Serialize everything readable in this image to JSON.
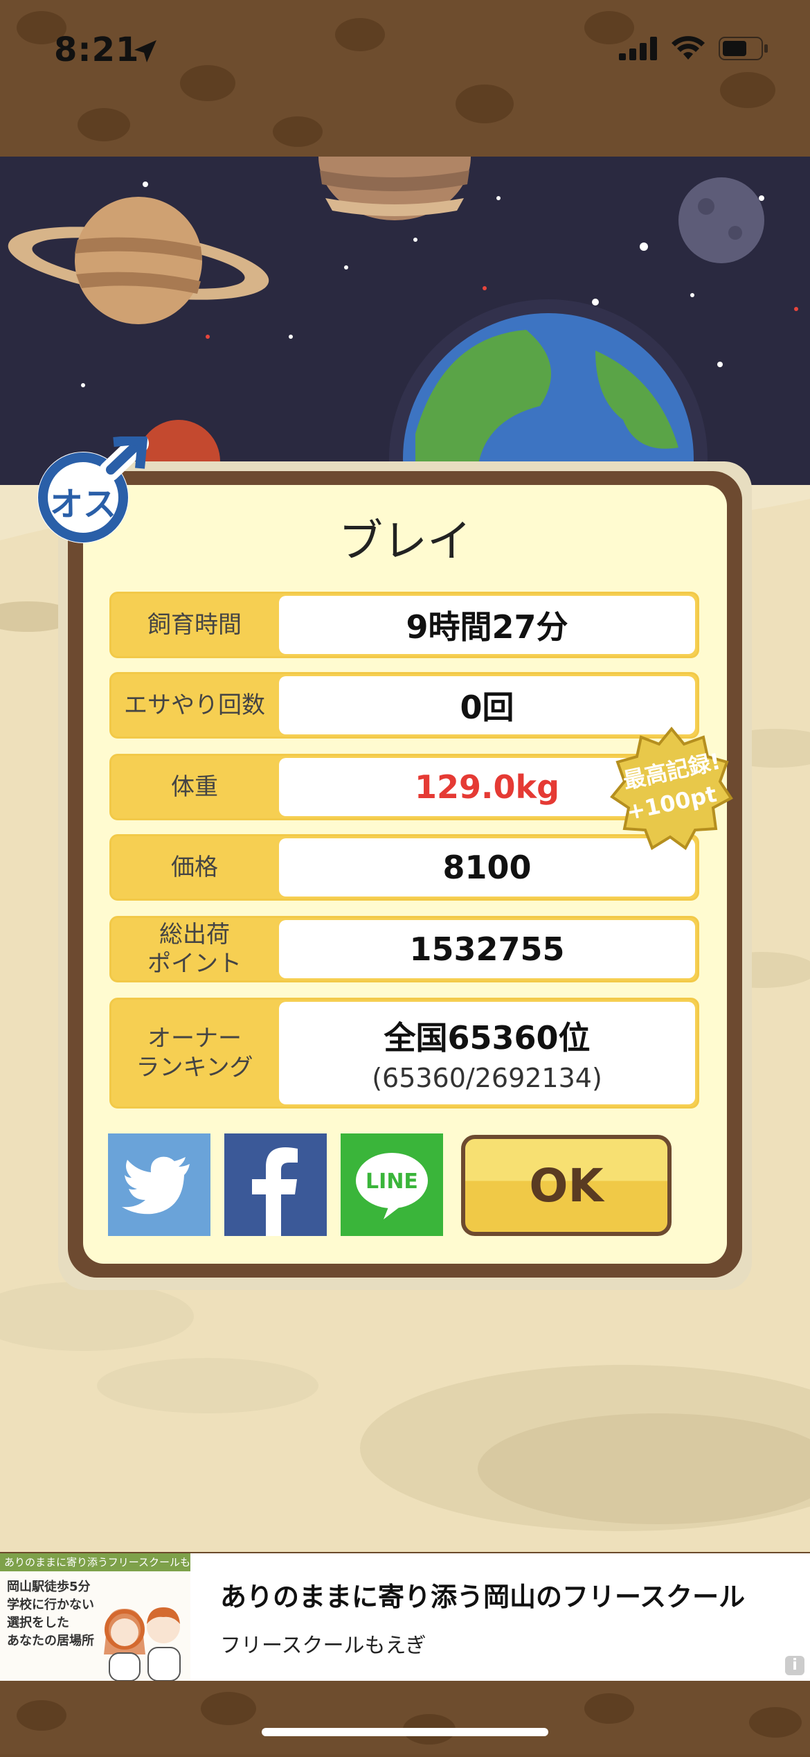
{
  "status_bar": {
    "time": "8:21"
  },
  "dialog": {
    "title": "ブレイ",
    "gender_badge": "オス",
    "record_badge": {
      "line1": "最高記録!",
      "line2": "+100pt"
    },
    "rows": [
      {
        "label": "飼育時間",
        "value": "9時間27分"
      },
      {
        "label": "エサやり回数",
        "value": "0回"
      },
      {
        "label": "体重",
        "value": "129.0kg"
      },
      {
        "label": "価格",
        "value": "8100"
      },
      {
        "label": "総出荷\nポイント",
        "label_l1": "総出荷",
        "label_l2": "ポイント",
        "value": "1532755"
      },
      {
        "label_l1": "オーナー",
        "label_l2": "ランキング",
        "value": "全国65360位",
        "sub": "(65360/2692134)"
      }
    ],
    "share": {
      "line_label": "LINE"
    },
    "ok_label": "OK"
  },
  "ad": {
    "image_header": "ありのままに寄り添うフリースクールもえぎ",
    "image_lines": [
      "岡山駅徒歩5分",
      "学校に行かない",
      "選択をした",
      "あなたの居場所"
    ],
    "title": "ありのままに寄り添う岡山のフリースクール",
    "subtitle": "フリースクールもえぎ",
    "info": "i"
  },
  "colors": {
    "accent": "#f6cf52",
    "frame": "#6d4a30",
    "weight_value": "#e53a34",
    "twitter": "#6aa3d9",
    "facebook": "#3b5998",
    "line": "#3ab53a"
  }
}
